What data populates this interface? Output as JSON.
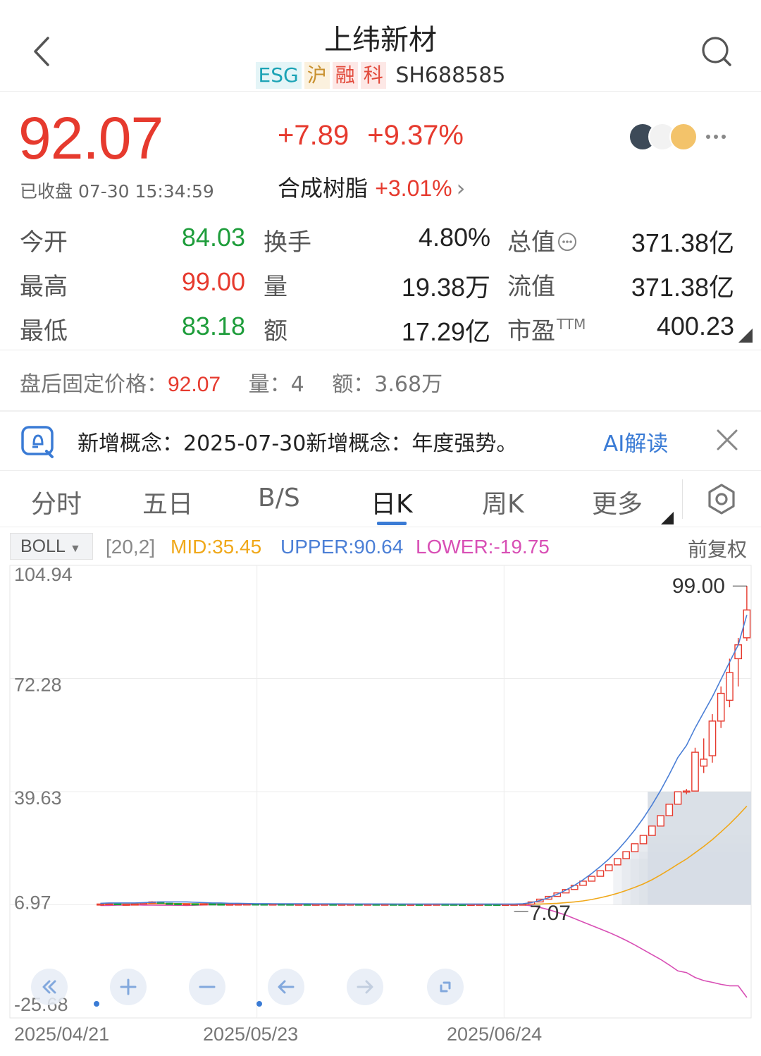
{
  "header": {
    "title": "上纬新材",
    "tags": [
      "ESG",
      "沪",
      "融",
      "科"
    ],
    "code": "SH688585"
  },
  "quote": {
    "price": "92.07",
    "change": "+7.89",
    "change_pct": "+9.37%",
    "status": "已收盘 07-30 15:34:59",
    "sector_name": "合成树脂",
    "sector_pct": "+3.01%",
    "sector_chevron": "›"
  },
  "stats": {
    "open_label": "今开",
    "open": "84.03",
    "high_label": "最高",
    "high": "99.00",
    "low_label": "最低",
    "low": "83.18",
    "turnover_label": "换手",
    "turnover": "4.80%",
    "volume_label": "量",
    "volume": "19.38万",
    "amount_label": "额",
    "amount": "17.29亿",
    "mktcap_label": "总值",
    "mktcap": "371.38亿",
    "float_label": "流值",
    "float_cap": "371.38亿",
    "pe_label": "市盈",
    "pe_sup": "TTM",
    "pe": "400.23"
  },
  "after_hours": {
    "price_label": "盘后固定价格：",
    "price": "92.07",
    "volume_label": "量：",
    "volume": "4",
    "amount_label": "额：",
    "amount": "3.68万"
  },
  "concept": {
    "text": "新增概念：2025-07-30新增概念：年度强势。",
    "ai_label": "AI解读"
  },
  "tabs": [
    "分时",
    "五日",
    "B/S",
    "日K",
    "周K",
    "更多"
  ],
  "active_tab": "日K",
  "indicator": {
    "name": "BOLL",
    "params": "[20,2]",
    "mid": "MID:35.45",
    "upper": "UPPER:90.64",
    "lower": "LOWER:-19.75",
    "adjust": "前复权"
  },
  "colors": {
    "up": "#e63a2e",
    "down": "#1e9d3b",
    "mid_line": "#f0a81a",
    "upper_line": "#4b7fd6",
    "lower_line": "#d84fb5",
    "accent": "#3a7bd5"
  },
  "chart_data": {
    "type": "candlestick",
    "y_ticks": [
      "104.94",
      "72.28",
      "39.63",
      "6.97",
      "-25.68"
    ],
    "ylim": [
      -25.68,
      104.94
    ],
    "x_ticks": [
      "2025/04/21",
      "2025/05/23",
      "2025/06/24"
    ],
    "max_label": "99.00",
    "min_label": "7.07",
    "ohlc": [
      {
        "o": 7.1,
        "h": 7.3,
        "l": 7.0,
        "c": 7.2
      },
      {
        "o": 7.2,
        "h": 7.5,
        "l": 7.1,
        "c": 7.3
      },
      {
        "o": 7.3,
        "h": 7.4,
        "l": 7.0,
        "c": 7.1
      },
      {
        "o": 7.1,
        "h": 7.2,
        "l": 7.0,
        "c": 7.15
      },
      {
        "o": 7.15,
        "h": 7.3,
        "l": 7.1,
        "c": 7.2
      },
      {
        "o": 7.2,
        "h": 7.6,
        "l": 7.1,
        "c": 7.5
      },
      {
        "o": 7.5,
        "h": 8.0,
        "l": 7.4,
        "c": 7.8
      },
      {
        "o": 7.8,
        "h": 7.9,
        "l": 7.3,
        "c": 7.4
      },
      {
        "o": 7.4,
        "h": 7.5,
        "l": 7.2,
        "c": 7.3
      },
      {
        "o": 7.3,
        "h": 7.4,
        "l": 7.1,
        "c": 7.2
      },
      {
        "o": 7.2,
        "h": 7.3,
        "l": 7.1,
        "c": 7.25
      },
      {
        "o": 7.25,
        "h": 7.3,
        "l": 7.1,
        "c": 7.15
      },
      {
        "o": 7.15,
        "h": 7.3,
        "l": 7.1,
        "c": 7.25
      },
      {
        "o": 7.25,
        "h": 7.3,
        "l": 7.1,
        "c": 7.2
      },
      {
        "o": 7.2,
        "h": 7.25,
        "l": 7.1,
        "c": 7.15
      },
      {
        "o": 7.15,
        "h": 7.2,
        "l": 7.1,
        "c": 7.18
      },
      {
        "o": 7.18,
        "h": 7.25,
        "l": 7.1,
        "c": 7.2
      },
      {
        "o": 7.2,
        "h": 7.3,
        "l": 7.12,
        "c": 7.22
      },
      {
        "o": 7.22,
        "h": 7.28,
        "l": 7.15,
        "c": 7.2
      },
      {
        "o": 7.2,
        "h": 7.25,
        "l": 7.12,
        "c": 7.16
      },
      {
        "o": 7.16,
        "h": 7.22,
        "l": 7.1,
        "c": 7.2
      },
      {
        "o": 7.2,
        "h": 7.24,
        "l": 7.12,
        "c": 7.18
      },
      {
        "o": 7.18,
        "h": 7.22,
        "l": 7.1,
        "c": 7.14
      },
      {
        "o": 7.14,
        "h": 7.2,
        "l": 7.08,
        "c": 7.16
      },
      {
        "o": 7.16,
        "h": 7.2,
        "l": 7.1,
        "c": 7.12
      },
      {
        "o": 7.12,
        "h": 7.18,
        "l": 7.08,
        "c": 7.15
      },
      {
        "o": 7.15,
        "h": 7.2,
        "l": 7.1,
        "c": 7.17
      },
      {
        "o": 7.17,
        "h": 7.22,
        "l": 7.12,
        "c": 7.14
      },
      {
        "o": 7.14,
        "h": 7.18,
        "l": 7.1,
        "c": 7.16
      },
      {
        "o": 7.16,
        "h": 7.2,
        "l": 7.12,
        "c": 7.18
      },
      {
        "o": 7.18,
        "h": 7.22,
        "l": 7.12,
        "c": 7.15
      },
      {
        "o": 7.15,
        "h": 7.2,
        "l": 7.1,
        "c": 7.17
      },
      {
        "o": 7.17,
        "h": 7.2,
        "l": 7.12,
        "c": 7.14
      },
      {
        "o": 7.14,
        "h": 7.18,
        "l": 7.1,
        "c": 7.16
      },
      {
        "o": 7.16,
        "h": 7.2,
        "l": 7.12,
        "c": 7.15
      },
      {
        "o": 7.15,
        "h": 7.18,
        "l": 7.1,
        "c": 7.13
      },
      {
        "o": 7.13,
        "h": 7.16,
        "l": 7.08,
        "c": 7.14
      },
      {
        "o": 7.14,
        "h": 7.18,
        "l": 7.1,
        "c": 7.12
      },
      {
        "o": 7.12,
        "h": 7.16,
        "l": 7.08,
        "c": 7.14
      },
      {
        "o": 7.14,
        "h": 7.18,
        "l": 7.1,
        "c": 7.16
      },
      {
        "o": 7.16,
        "h": 7.2,
        "l": 7.12,
        "c": 7.15
      },
      {
        "o": 7.15,
        "h": 7.18,
        "l": 7.1,
        "c": 7.12
      },
      {
        "o": 7.12,
        "h": 7.16,
        "l": 7.08,
        "c": 7.1
      },
      {
        "o": 7.1,
        "h": 7.14,
        "l": 7.07,
        "c": 7.12
      },
      {
        "o": 7.12,
        "h": 7.16,
        "l": 7.08,
        "c": 7.14
      },
      {
        "o": 7.14,
        "h": 7.18,
        "l": 7.1,
        "c": 7.12
      },
      {
        "o": 7.12,
        "h": 7.16,
        "l": 7.08,
        "c": 7.1
      },
      {
        "o": 7.1,
        "h": 7.14,
        "l": 7.07,
        "c": 7.12
      },
      {
        "o": 7.12,
        "h": 7.16,
        "l": 7.1,
        "c": 7.14
      },
      {
        "o": 7.14,
        "h": 7.2,
        "l": 7.1,
        "c": 7.18
      },
      {
        "o": 7.18,
        "h": 7.4,
        "l": 7.15,
        "c": 7.8
      },
      {
        "o": 7.8,
        "h": 8.6,
        "l": 7.8,
        "c": 8.6
      },
      {
        "o": 8.6,
        "h": 9.4,
        "l": 8.6,
        "c": 9.4
      },
      {
        "o": 9.4,
        "h": 10.4,
        "l": 9.4,
        "c": 10.4
      },
      {
        "o": 10.4,
        "h": 11.4,
        "l": 10.4,
        "c": 11.4
      },
      {
        "o": 11.4,
        "h": 12.6,
        "l": 11.4,
        "c": 12.6
      },
      {
        "o": 12.6,
        "h": 13.8,
        "l": 12.6,
        "c": 13.8
      },
      {
        "o": 13.8,
        "h": 15.2,
        "l": 13.8,
        "c": 15.2
      },
      {
        "o": 15.2,
        "h": 16.8,
        "l": 15.2,
        "c": 16.8
      },
      {
        "o": 16.8,
        "h": 18.5,
        "l": 16.8,
        "c": 18.5
      },
      {
        "o": 18.5,
        "h": 20.3,
        "l": 18.5,
        "c": 20.3
      },
      {
        "o": 20.3,
        "h": 22.3,
        "l": 20.3,
        "c": 22.3
      },
      {
        "o": 22.3,
        "h": 24.6,
        "l": 22.3,
        "c": 24.6
      },
      {
        "o": 24.6,
        "h": 27.0,
        "l": 24.6,
        "c": 27.0
      },
      {
        "o": 27.0,
        "h": 29.7,
        "l": 27.0,
        "c": 29.7
      },
      {
        "o": 29.7,
        "h": 32.7,
        "l": 29.7,
        "c": 32.7
      },
      {
        "o": 32.7,
        "h": 36.0,
        "l": 32.7,
        "c": 36.0
      },
      {
        "o": 36.0,
        "h": 39.6,
        "l": 36.0,
        "c": 39.6
      },
      {
        "o": 39.6,
        "h": 40.4,
        "l": 38.9,
        "c": 39.8
      },
      {
        "o": 39.8,
        "h": 52.3,
        "l": 39.8,
        "c": 51.0
      },
      {
        "o": 47.0,
        "h": 55.0,
        "l": 45.0,
        "c": 49.0
      },
      {
        "o": 50.0,
        "h": 62.0,
        "l": 48.0,
        "c": 60.0
      },
      {
        "o": 60.0,
        "h": 70.0,
        "l": 58.0,
        "c": 68.0
      },
      {
        "o": 66.0,
        "h": 78.0,
        "l": 64.0,
        "c": 74.0
      },
      {
        "o": 78.0,
        "h": 84.0,
        "l": 70.0,
        "c": 82.0
      },
      {
        "o": 84.03,
        "h": 99.0,
        "l": 83.18,
        "c": 92.07
      }
    ],
    "boll_upper": [
      7.4,
      7.5,
      7.5,
      7.5,
      7.5,
      7.6,
      7.7,
      7.8,
      7.8,
      7.8,
      7.8,
      7.7,
      7.6,
      7.5,
      7.5,
      7.4,
      7.4,
      7.35,
      7.3,
      7.3,
      7.28,
      7.27,
      7.26,
      7.25,
      7.25,
      7.24,
      7.24,
      7.23,
      7.23,
      7.22,
      7.22,
      7.22,
      7.21,
      7.21,
      7.2,
      7.2,
      7.2,
      7.2,
      7.2,
      7.2,
      7.2,
      7.2,
      7.2,
      7.2,
      7.2,
      7.2,
      7.2,
      7.2,
      7.2,
      7.25,
      7.6,
      8.2,
      9.0,
      10.0,
      11.2,
      12.6,
      14.2,
      16.0,
      18.0,
      20.2,
      22.7,
      25.5,
      28.6,
      32.0,
      35.8,
      40.0,
      44.6,
      49.5,
      53.0,
      58.0,
      62.5,
      67.0,
      72.0,
      77.0,
      82.0,
      90.64
    ],
    "boll_mid": [
      7.1,
      7.15,
      7.2,
      7.2,
      7.22,
      7.25,
      7.3,
      7.33,
      7.33,
      7.32,
      7.3,
      7.28,
      7.27,
      7.26,
      7.25,
      7.23,
      7.22,
      7.21,
      7.2,
      7.2,
      7.19,
      7.18,
      7.18,
      7.17,
      7.17,
      7.16,
      7.16,
      7.16,
      7.16,
      7.16,
      7.15,
      7.15,
      7.15,
      7.15,
      7.15,
      7.14,
      7.14,
      7.14,
      7.14,
      7.14,
      7.14,
      7.14,
      7.13,
      7.13,
      7.13,
      7.13,
      7.13,
      7.12,
      7.12,
      7.13,
      7.16,
      7.2,
      7.3,
      7.4,
      7.6,
      7.8,
      8.1,
      8.5,
      9.0,
      9.6,
      10.3,
      11.1,
      12.0,
      13.0,
      14.2,
      15.6,
      17.1,
      18.7,
      20.2,
      22.0,
      23.8,
      25.8,
      28.0,
      30.3,
      32.8,
      35.45
    ],
    "boll_lower": [
      6.8,
      6.8,
      6.9,
      6.9,
      6.95,
      6.9,
      6.9,
      6.86,
      6.86,
      6.84,
      6.8,
      6.86,
      6.94,
      7.02,
      7.0,
      7.06,
      7.04,
      7.07,
      7.1,
      7.1,
      7.1,
      7.09,
      7.1,
      7.09,
      7.09,
      7.08,
      7.08,
      7.09,
      7.09,
      7.1,
      7.08,
      7.08,
      7.09,
      7.09,
      7.1,
      7.08,
      7.08,
      7.08,
      7.08,
      7.08,
      7.08,
      7.08,
      7.06,
      7.06,
      7.06,
      7.06,
      7.06,
      7.04,
      7.04,
      7.01,
      6.7,
      6.2,
      5.6,
      4.8,
      4.0,
      3.0,
      2.0,
      1.0,
      0.0,
      -1.0,
      -2.1,
      -3.3,
      -4.6,
      -6.0,
      -7.4,
      -8.8,
      -10.4,
      -12.1,
      -12.6,
      -14.0,
      -14.9,
      -15.4,
      -16.0,
      -16.4,
      -16.4,
      -19.75
    ]
  },
  "icons": {
    "back": "chevron-left-icon",
    "search": "search-icon",
    "concept": "bell-chat-icon",
    "close": "close-icon",
    "settings": "hexagon-settings-icon",
    "more": "ellipsis-icon"
  }
}
